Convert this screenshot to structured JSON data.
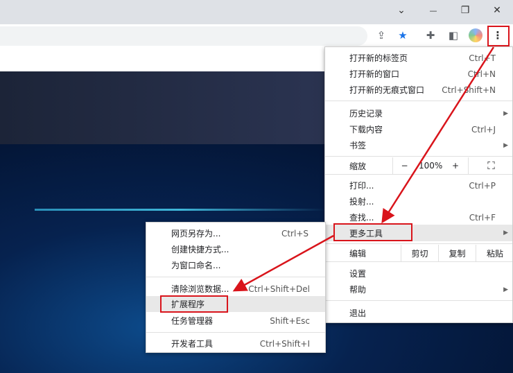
{
  "window": {
    "minimize": "⌄",
    "min2": "—",
    "restore": "❐",
    "close": "✕"
  },
  "toolbar": {
    "share": "⇪",
    "star": "★",
    "extensions": "✚",
    "sidepanel": "◧",
    "menu": "⋮"
  },
  "main_menu": {
    "items": [
      {
        "label": "打开新的标签页",
        "shortcut": "Ctrl+T"
      },
      {
        "label": "打开新的窗口",
        "shortcut": "Ctrl+N"
      },
      {
        "label": "打开新的无痕式窗口",
        "shortcut": "Ctrl+Shift+N"
      },
      {
        "label": "历史记录",
        "shortcut": ""
      },
      {
        "label": "下载内容",
        "shortcut": "Ctrl+J"
      },
      {
        "label": "书签",
        "shortcut": ""
      },
      {
        "label": "打印...",
        "shortcut": "Ctrl+P"
      },
      {
        "label": "投射...",
        "shortcut": ""
      },
      {
        "label": "查找...",
        "shortcut": "Ctrl+F"
      },
      {
        "label": "更多工具",
        "shortcut": ""
      },
      {
        "label": "设置",
        "shortcut": ""
      },
      {
        "label": "帮助",
        "shortcut": ""
      },
      {
        "label": "退出",
        "shortcut": ""
      }
    ],
    "zoom": {
      "label": "缩放",
      "minus": "−",
      "value": "100%",
      "plus": "+",
      "fullscreen": "⛶"
    },
    "edit": {
      "label": "编辑",
      "cut": "剪切",
      "copy": "复制",
      "paste": "粘贴"
    }
  },
  "sub_menu": {
    "items": [
      {
        "label": "网页另存为...",
        "shortcut": "Ctrl+S"
      },
      {
        "label": "创建快捷方式...",
        "shortcut": ""
      },
      {
        "label": "为窗口命名...",
        "shortcut": ""
      },
      {
        "label": "清除浏览数据...",
        "shortcut": "Ctrl+Shift+Del"
      },
      {
        "label": "扩展程序",
        "shortcut": ""
      },
      {
        "label": "任务管理器",
        "shortcut": "Shift+Esc"
      },
      {
        "label": "开发者工具",
        "shortcut": "Ctrl+Shift+I"
      }
    ]
  },
  "colors": {
    "annotation": "#d9141b",
    "star": "#1a73e8"
  }
}
